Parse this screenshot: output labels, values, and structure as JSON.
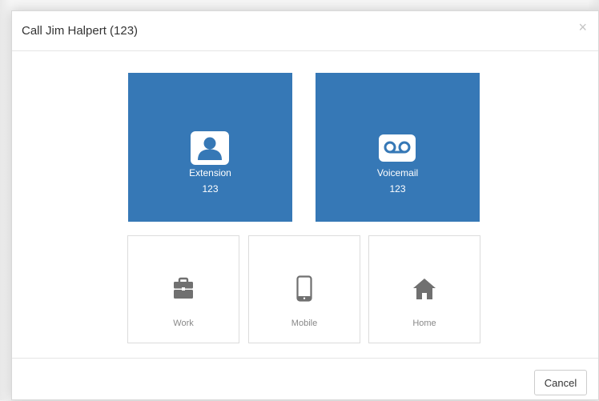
{
  "dialog": {
    "title": "Call Jim Halpert (123)",
    "close_glyph": "×"
  },
  "primary_options": [
    {
      "label": "Extension",
      "number": "123",
      "icon": "person-icon"
    },
    {
      "label": "Voicemail",
      "number": "123",
      "icon": "voicemail-icon"
    }
  ],
  "secondary_options": [
    {
      "label": "Work",
      "icon": "briefcase-icon"
    },
    {
      "label": "Mobile",
      "icon": "mobile-phone-icon"
    },
    {
      "label": "Home",
      "icon": "home-icon"
    }
  ],
  "footer": {
    "cancel_label": "Cancel"
  },
  "colors": {
    "primary_tile": "#3678b6",
    "secondary_icon": "#707070",
    "secondary_text": "#888888"
  }
}
